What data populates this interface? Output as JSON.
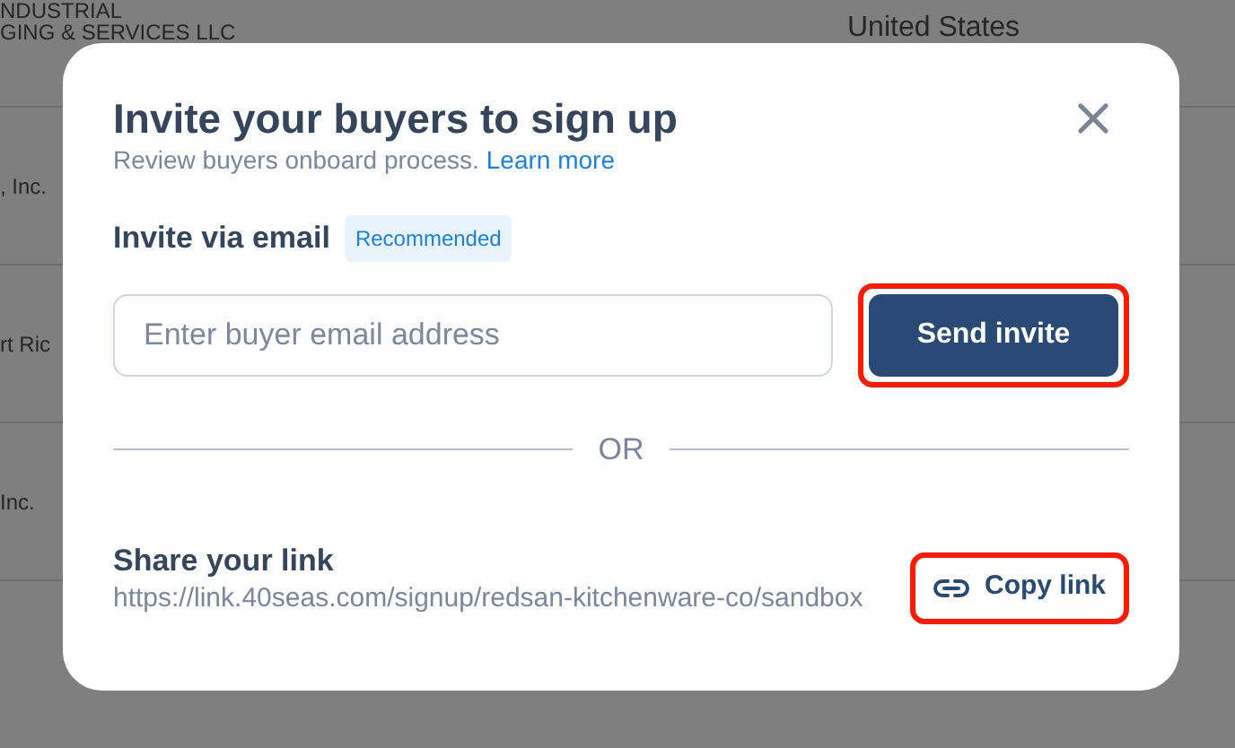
{
  "background_table": {
    "rows": [
      {
        "column_1": [
          "NDUSTRIAL",
          "GING & SERVICES LLC"
        ],
        "column_2": "United States"
      },
      {
        "column_1": [
          ", Inc."
        ]
      },
      {
        "column_1": [
          "rt Ric"
        ]
      },
      {
        "column_1": [
          "Inc."
        ]
      }
    ]
  },
  "dialog": {
    "title": "Invite your buyers to sign up",
    "subtitle": "Review buyers onboard process.",
    "subtitle_link": "Learn more",
    "email_section": {
      "label": "Invite via email",
      "badge": "Recommended",
      "placeholder": "Enter buyer email address",
      "button": {
        "label": "Send invite",
        "highlighted": true
      }
    },
    "divider_text": "OR",
    "link_section": {
      "label": "Share your link",
      "url": "https://link.40seas.com/signup/redsan-kitchenware-co/sandbox",
      "button": {
        "label": "Copy link",
        "highlighted": true
      }
    }
  }
}
